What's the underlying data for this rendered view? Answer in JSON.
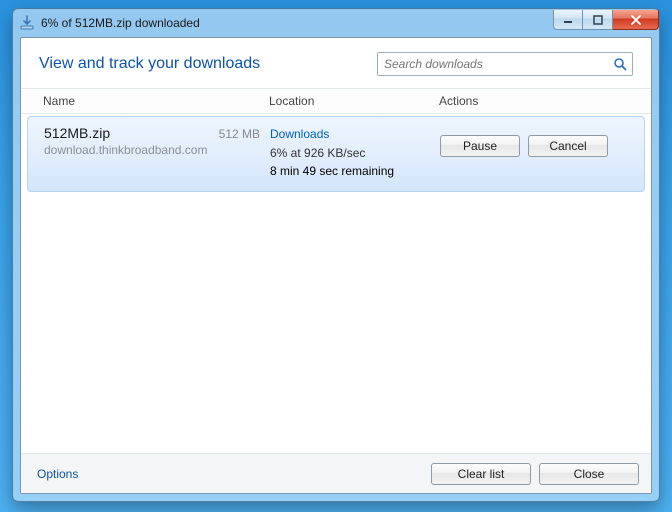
{
  "window": {
    "title": "6% of 512MB.zip downloaded"
  },
  "header": {
    "page_title": "View and track your downloads",
    "search_placeholder": "Search downloads"
  },
  "columns": {
    "name": "Name",
    "location": "Location",
    "actions": "Actions"
  },
  "download": {
    "filename": "512MB.zip",
    "filesize": "512 MB",
    "source": "download.thinkbroadband.com",
    "location_link": "Downloads",
    "progress_line": "6% at 926 KB/sec",
    "eta": "8 min 49 sec remaining",
    "pause_label": "Pause",
    "cancel_label": "Cancel"
  },
  "footer": {
    "options": "Options",
    "clear": "Clear list",
    "close": "Close"
  }
}
